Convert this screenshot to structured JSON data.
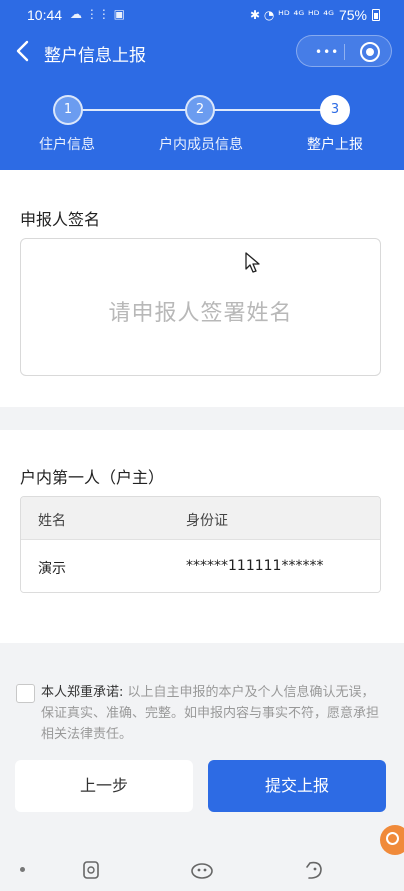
{
  "status_bar": {
    "time": "10:44",
    "left_icons": "☁ ⋮⋮ ▣",
    "right_icons": "✱ ◔ ᴴᴰ ⁴ᴳ ᴴᴰ ⁴ᴳ",
    "battery": "75%"
  },
  "nav": {
    "title": "整户信息上报",
    "back_icon": "chevron-left-icon",
    "capsule_more": "•••",
    "capsule_close_icon": "target-icon"
  },
  "steps": [
    {
      "number": "1",
      "label": "住户信息",
      "active": false
    },
    {
      "number": "2",
      "label": "户内成员信息",
      "active": false
    },
    {
      "number": "3",
      "label": "整户上报",
      "active": true
    }
  ],
  "signature": {
    "title": "申报人签名",
    "placeholder": "请申报人签署姓名"
  },
  "household": {
    "title": "户内第一人（户主）",
    "columns": [
      "姓名",
      "身份证"
    ],
    "rows": [
      {
        "name": "演示",
        "id": "******111111******"
      }
    ]
  },
  "promise": {
    "strong": "本人郑重承诺:",
    "text": " 以上自主申报的本户及个人信息确认无误，保证真实、准确、完整。如申报内容与事实不符，愿意承担相关法律责任。"
  },
  "buttons": {
    "prev": "上一步",
    "submit": "提交上报"
  },
  "colors": {
    "primary": "#2d6be4",
    "background": "#f2f3f5"
  }
}
